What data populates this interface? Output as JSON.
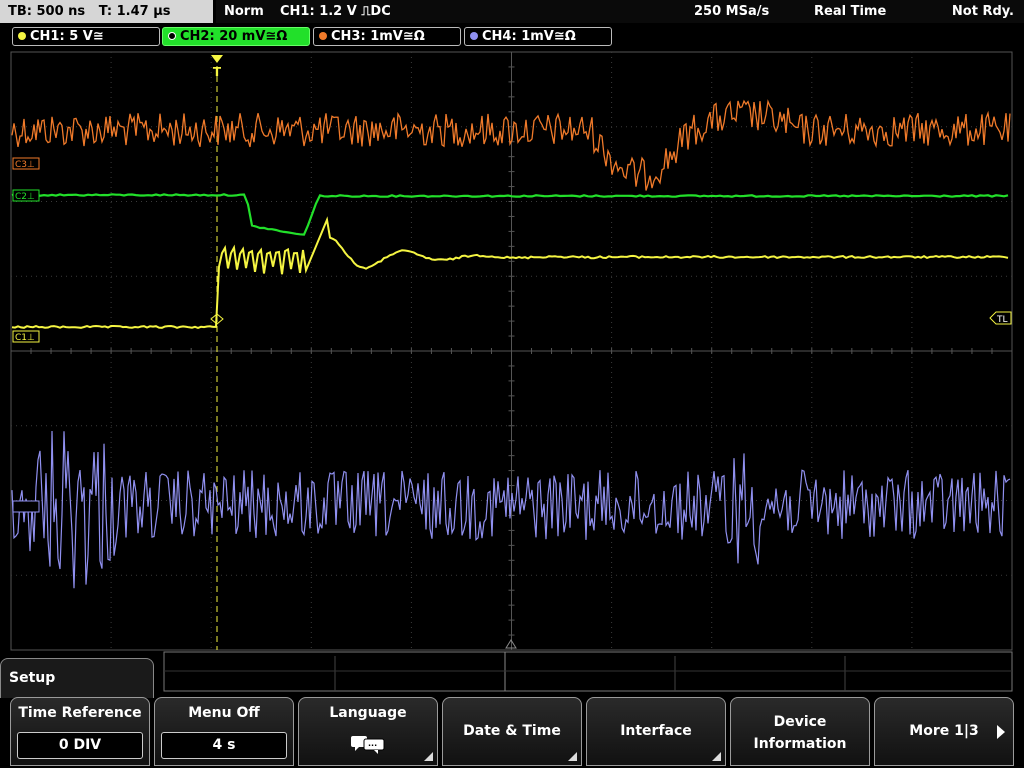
{
  "status_bar": {
    "timebase": "TB: 500 ns   T: 1.47 µs",
    "trigger_mode": "Norm",
    "trigger_info": "CH1: 1.2 V ⎍DC",
    "sample_rate": "250 MSa/s",
    "acq_mode": "Real Time",
    "run_state": "Not Rdy."
  },
  "channels": [
    {
      "label": "CH1: 5 V≅",
      "color": "#f5f542",
      "active": false
    },
    {
      "label": "CH2: 20 mV≅Ω",
      "color": "#22e02a",
      "active": true
    },
    {
      "label": "CH3: 1mV≅Ω",
      "color": "#f07a2a",
      "active": false
    },
    {
      "label": "CH4: 1mV≅Ω",
      "color": "#9090f0",
      "active": false
    }
  ],
  "markers": {
    "ch1": "C1⊥",
    "ch2": "C2⊥",
    "ch3": "C3⊥",
    "trigger_level": "TL",
    "trigger_pos": "T"
  },
  "menu": {
    "title": "Setup",
    "softkeys": [
      {
        "name": "time-reference",
        "title": "Time Reference",
        "value": "0 DIV"
      },
      {
        "name": "menu-off",
        "title": "Menu Off",
        "value": "4 s"
      },
      {
        "name": "language",
        "title": "Language",
        "icon": "speech-bubbles-icon"
      },
      {
        "name": "date-time",
        "title": "Date & Time"
      },
      {
        "name": "interface",
        "title": "Interface"
      },
      {
        "name": "device-information",
        "line1": "Device",
        "line2": "Information"
      },
      {
        "name": "more",
        "title": "More 1|3"
      }
    ]
  }
}
